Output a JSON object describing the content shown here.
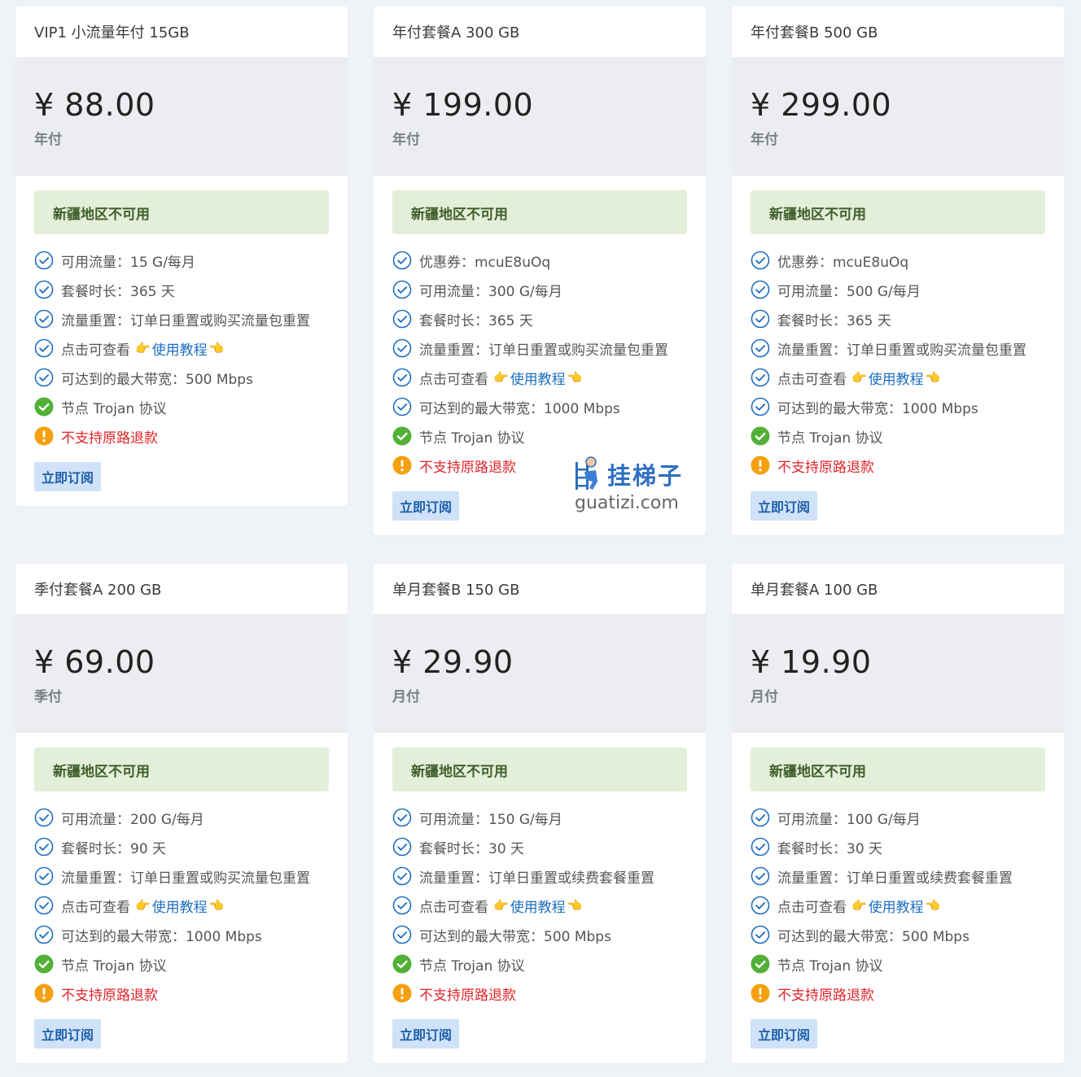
{
  "colors": {
    "page_bg": "#eff2f7",
    "notice_bg": "#e3efd9",
    "notice_text": "#3f5e2b",
    "check_blue": "#1e6fc1",
    "check_green": "#52b037",
    "warn_orange": "#f5a00f",
    "warn_text": "#e0242b",
    "button_bg": "#cfe2f8",
    "link": "#1e6fc1"
  },
  "common": {
    "notice": "新疆地区不可用",
    "subscribe_label": "立即订阅",
    "tutorial_prefix": "点击可查看",
    "tutorial_link": "使用教程",
    "emoji_left": "👉",
    "emoji_right": "👈",
    "protocol": "节点 Trojan 协议",
    "no_refund": "不支持原路退款"
  },
  "watermark": {
    "title": "挂梯子",
    "url": "guatizi.com"
  },
  "plans": [
    {
      "name": "VIP1 小流量年付 15GB",
      "price": "¥ 88.00",
      "period": "年付",
      "features": [
        {
          "icon": "check-circle-icon",
          "text": "可用流量：15 G/每月"
        },
        {
          "icon": "check-circle-icon",
          "text": "套餐时长：365 天"
        },
        {
          "icon": "check-circle-icon",
          "text": "流量重置：订单日重置或购买流量包重置"
        },
        {
          "icon": "check-circle-icon",
          "type": "tutorial"
        },
        {
          "icon": "check-circle-icon",
          "text": "可达到的最大带宽：500 Mbps"
        },
        {
          "icon": "green-check-icon",
          "type": "protocol"
        },
        {
          "icon": "warning-icon",
          "type": "refund"
        }
      ]
    },
    {
      "name": "年付套餐A 300 GB",
      "price": "¥ 199.00",
      "period": "年付",
      "features": [
        {
          "icon": "check-circle-icon",
          "text": "优惠券：mcuE8uOq"
        },
        {
          "icon": "check-circle-icon",
          "text": "可用流量：300 G/每月"
        },
        {
          "icon": "check-circle-icon",
          "text": "套餐时长：365 天"
        },
        {
          "icon": "check-circle-icon",
          "text": "流量重置：订单日重置或购买流量包重置"
        },
        {
          "icon": "check-circle-icon",
          "type": "tutorial"
        },
        {
          "icon": "check-circle-icon",
          "text": "可达到的最大带宽：1000 Mbps"
        },
        {
          "icon": "green-check-icon",
          "type": "protocol"
        },
        {
          "icon": "warning-icon",
          "type": "refund"
        }
      ]
    },
    {
      "name": "年付套餐B 500 GB",
      "price": "¥ 299.00",
      "period": "年付",
      "features": [
        {
          "icon": "check-circle-icon",
          "text": "优惠券：mcuE8uOq"
        },
        {
          "icon": "check-circle-icon",
          "text": "可用流量：500 G/每月"
        },
        {
          "icon": "check-circle-icon",
          "text": "套餐时长：365 天"
        },
        {
          "icon": "check-circle-icon",
          "text": "流量重置：订单日重置或购买流量包重置"
        },
        {
          "icon": "check-circle-icon",
          "type": "tutorial"
        },
        {
          "icon": "check-circle-icon",
          "text": "可达到的最大带宽：1000 Mbps"
        },
        {
          "icon": "green-check-icon",
          "type": "protocol"
        },
        {
          "icon": "warning-icon",
          "type": "refund"
        }
      ]
    },
    {
      "name": "季付套餐A 200 GB",
      "price": "¥ 69.00",
      "period": "季付",
      "features": [
        {
          "icon": "check-circle-icon",
          "text": "可用流量：200 G/每月"
        },
        {
          "icon": "check-circle-icon",
          "text": "套餐时长：90 天"
        },
        {
          "icon": "check-circle-icon",
          "text": "流量重置：订单日重置或购买流量包重置"
        },
        {
          "icon": "check-circle-icon",
          "type": "tutorial"
        },
        {
          "icon": "check-circle-icon",
          "text": "可达到的最大带宽：1000 Mbps"
        },
        {
          "icon": "green-check-icon",
          "type": "protocol"
        },
        {
          "icon": "warning-icon",
          "type": "refund"
        }
      ]
    },
    {
      "name": "单月套餐B 150 GB",
      "price": "¥ 29.90",
      "period": "月付",
      "features": [
        {
          "icon": "check-circle-icon",
          "text": "可用流量：150 G/每月"
        },
        {
          "icon": "check-circle-icon",
          "text": "套餐时长：30 天"
        },
        {
          "icon": "check-circle-icon",
          "text": "流量重置：订单日重置或续费套餐重置"
        },
        {
          "icon": "check-circle-icon",
          "type": "tutorial"
        },
        {
          "icon": "check-circle-icon",
          "text": "可达到的最大带宽：500 Mbps"
        },
        {
          "icon": "green-check-icon",
          "type": "protocol"
        },
        {
          "icon": "warning-icon",
          "type": "refund"
        }
      ]
    },
    {
      "name": "单月套餐A 100 GB",
      "price": "¥ 19.90",
      "period": "月付",
      "features": [
        {
          "icon": "check-circle-icon",
          "text": "可用流量：100 G/每月"
        },
        {
          "icon": "check-circle-icon",
          "text": "套餐时长：30 天"
        },
        {
          "icon": "check-circle-icon",
          "text": "流量重置：订单日重置或续费套餐重置"
        },
        {
          "icon": "check-circle-icon",
          "type": "tutorial"
        },
        {
          "icon": "check-circle-icon",
          "text": "可达到的最大带宽：500 Mbps"
        },
        {
          "icon": "green-check-icon",
          "type": "protocol"
        },
        {
          "icon": "warning-icon",
          "type": "refund"
        }
      ]
    }
  ]
}
